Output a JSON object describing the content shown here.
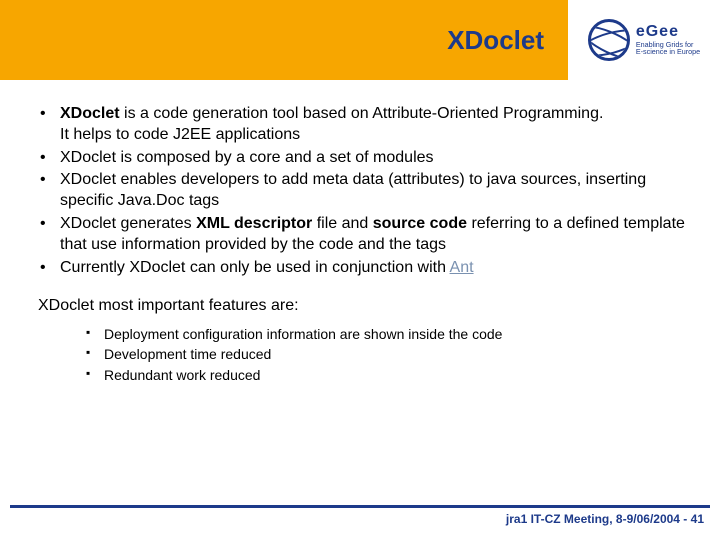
{
  "header": {
    "title": "XDoclet",
    "logo": {
      "name": "eGee",
      "tagline1": "Enabling Grids for",
      "tagline2": "E-science in Europe"
    }
  },
  "bullets": {
    "b1_part1": "XDoclet",
    "b1_part2": " is a code generation tool based on Attribute-Oriented Programming.",
    "b1_line2": "It helps to code J2EE applications",
    "b2": "XDoclet is composed by a core and a set of modules",
    "b3": "XDoclet enables developers to add meta data (attributes) to java sources, inserting specific Java.Doc tags",
    "b4_part1": "XDoclet generates ",
    "b4_bold1": "XML descriptor",
    "b4_mid": " file and ",
    "b4_bold2": "source code",
    "b4_part2": " referring to a defined template that use information provided by the code and the tags",
    "b5_part1": "Currently XDoclet can only be used in conjunction with ",
    "b5_link": "Ant"
  },
  "features": {
    "intro": "XDoclet most important features are:",
    "f1": "Deployment configuration information are shown inside the code",
    "f2": "Development time reduced",
    "f3": "Redundant work reduced"
  },
  "footer": {
    "text": "jra1 IT-CZ Meeting, 8-9/06/2004  - ",
    "page": "41"
  }
}
